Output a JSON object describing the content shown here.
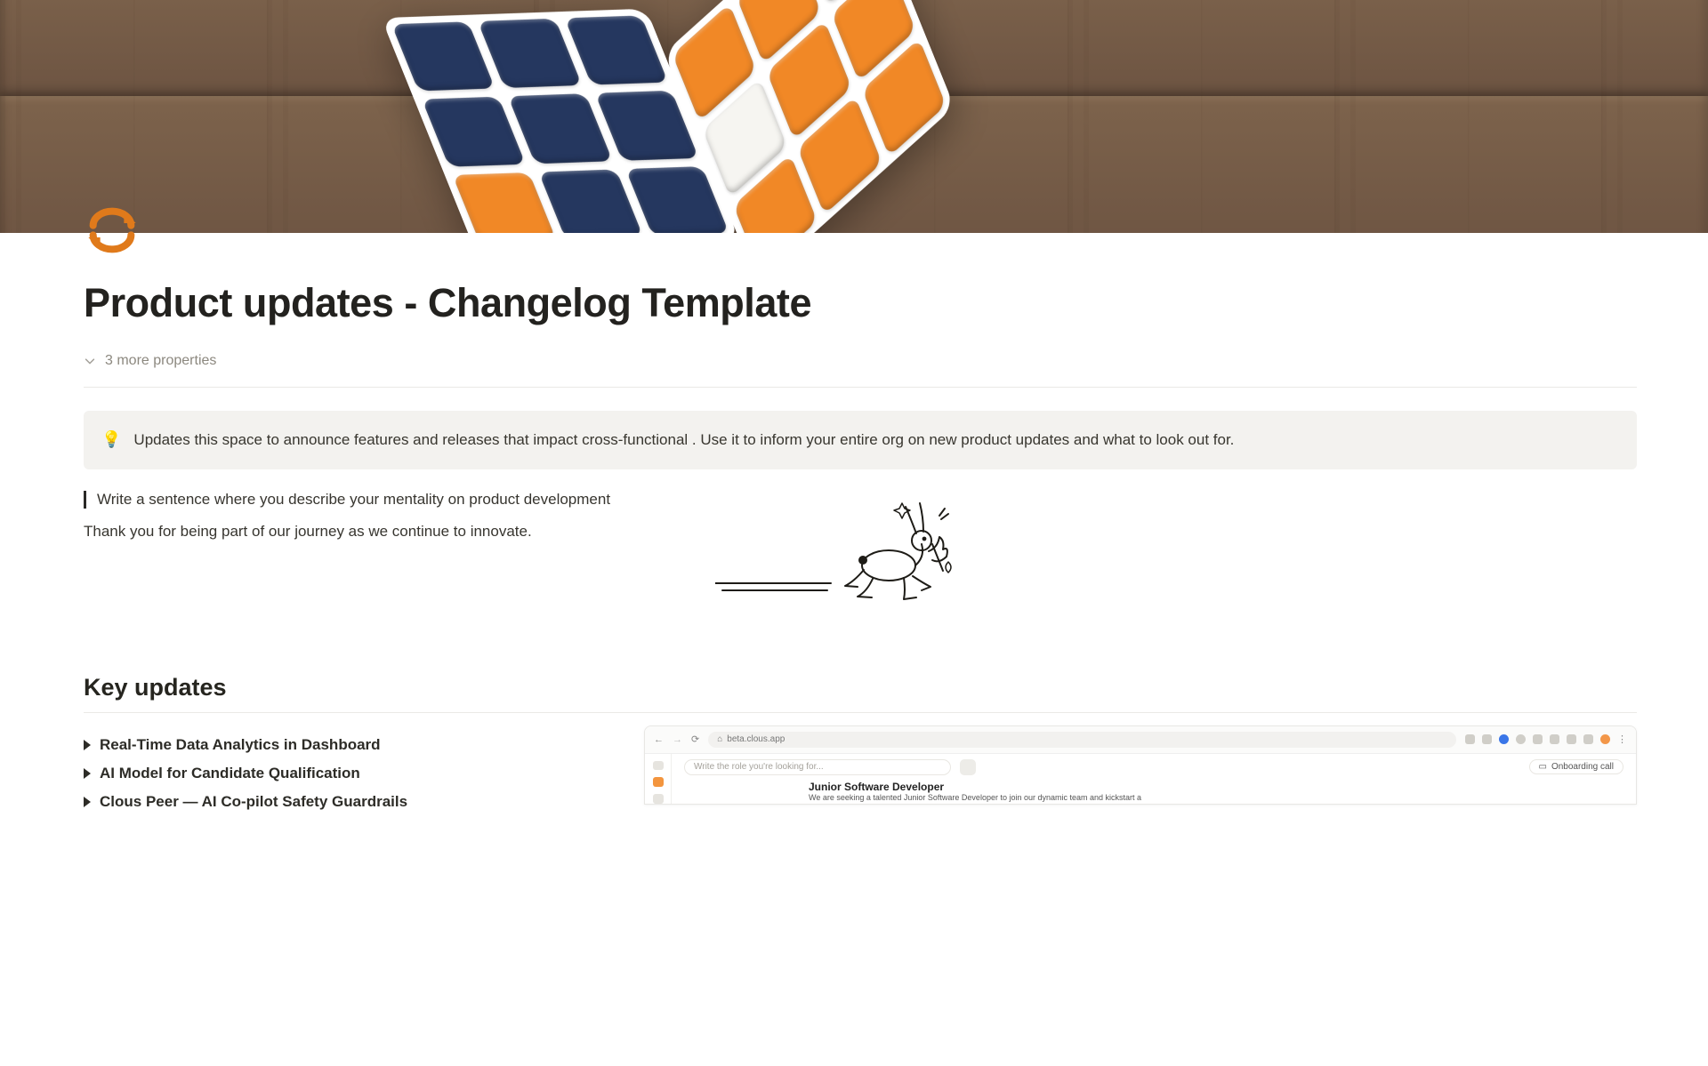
{
  "page": {
    "title": "Product updates - Changelog Template",
    "more_props": "3 more properties"
  },
  "callout": {
    "emoji": "💡",
    "text": "Updates this space to announce features and releases that impact cross-functional . Use it to inform your entire org on new product updates and what to look out for."
  },
  "quote_text": "Write a sentence where you describe your mentality on product development",
  "thanks_text": "Thank you for being part of our journey as we continue to innovate.",
  "section_title": "Key updates",
  "updates": [
    "Real-Time Data Analytics in Dashboard",
    "AI Model for Candidate Qualification",
    "Clous Peer — AI Co-pilot Safety Guardrails"
  ],
  "browser": {
    "url": "beta.clous.app",
    "search_placeholder": "Write the role you're looking for...",
    "onboarding_btn": "Onboarding call",
    "job_title": "Junior Software Developer",
    "job_sub": "We are seeking a talented Junior Software Developer to join our dynamic team and kickstart a"
  },
  "icons": {
    "page_icon": "repeat-icon"
  }
}
